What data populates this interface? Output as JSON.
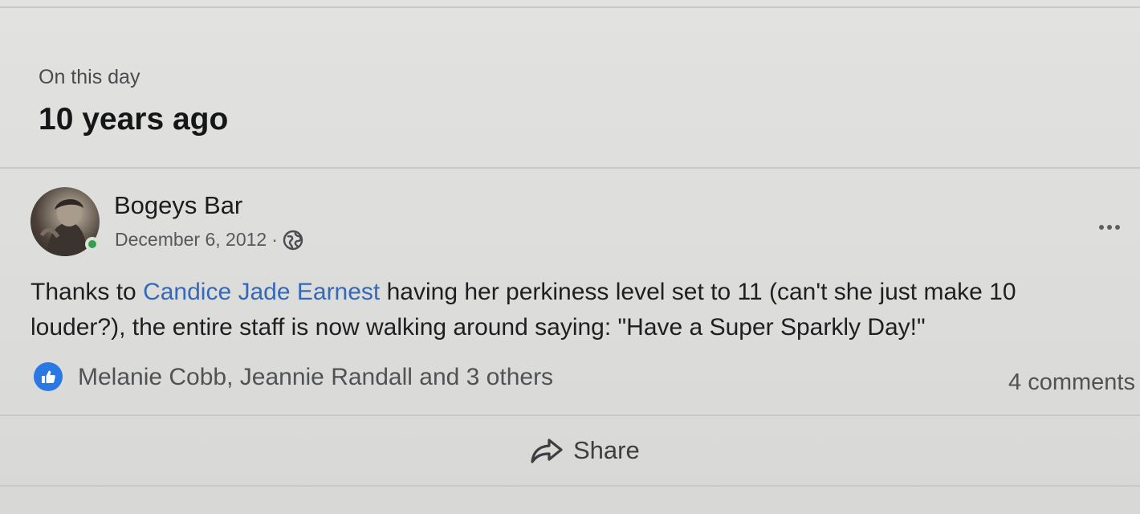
{
  "memory": {
    "eyebrow": "On this day",
    "headline": "10 years ago"
  },
  "post": {
    "author": "Bogeys Bar",
    "date": "December 6, 2012",
    "separator": "·",
    "privacy_icon": "globe-icon",
    "more_icon": "more-options-icon",
    "body_before": "Thanks to ",
    "mention": "Candice Jade Earnest",
    "body_after": " having her perkiness level set to 11 (can't she just make 10 louder?), the entire staff is now walking around saying: \"Have a Super Sparkly Day!\""
  },
  "reactions": {
    "icon": "like-icon",
    "summary": "Melanie Cobb, Jeannie Randall and 3 others",
    "comments": "4 comments"
  },
  "actions": {
    "share_icon": "share-icon",
    "share_label": "Share"
  },
  "colors": {
    "mention": "#3469b8",
    "like": "#2a78e4",
    "online": "#31a24c"
  }
}
